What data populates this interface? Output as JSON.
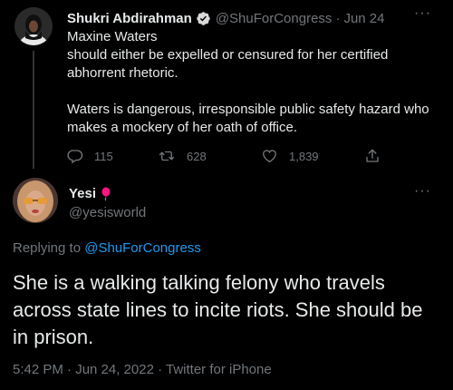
{
  "parent_tweet": {
    "author_name": "Shukri Abdirahman",
    "handle": "@ShuForCongress",
    "separator": "·",
    "date": "Jun 24",
    "lines": [
      "Maxine Waters",
      "should either be expelled or censured for her certified",
      "abhorrent rhetoric.",
      "Waters is dangerous, irresponsible public safety hazard who",
      "makes a mockery of her oath of office."
    ],
    "replies": "115",
    "retweets": "628",
    "likes": "1,839",
    "more": "···"
  },
  "reply_tweet": {
    "author_name": "Yesi",
    "name_emoji": "balloon-icon",
    "handle": "@yesisworld",
    "replying_prefix": "Replying to",
    "replying_mention": "@ShuForCongress",
    "text": "She is a walking talking felony who travels across state lines to incite riots. She should be in prison.",
    "timestamp": "5:42 PM · Jun 24, 2022 · Twitter for iPhone",
    "more": "···"
  },
  "colors": {
    "background": "#000000",
    "text": "#e7e9ea",
    "secondary": "#71767b",
    "accent": "#1d9bf0",
    "verified": "#1d9bf0",
    "balloon": "#f91880"
  }
}
